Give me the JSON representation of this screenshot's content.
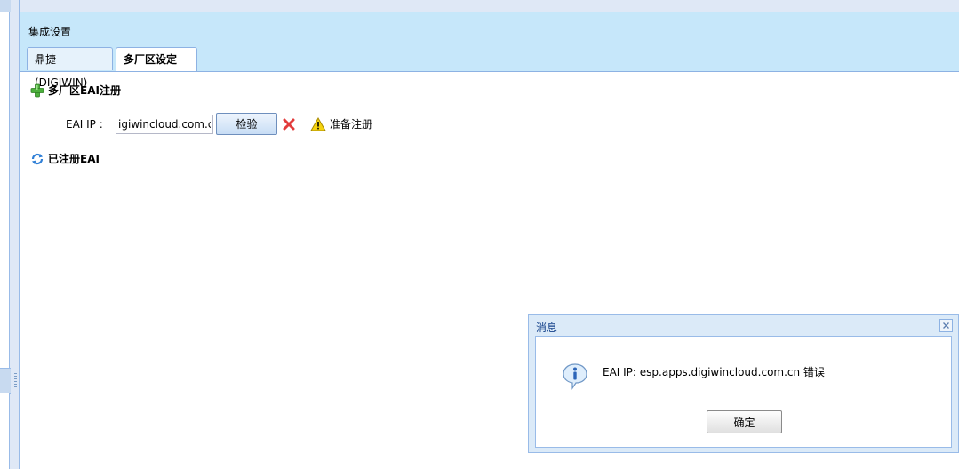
{
  "panel": {
    "title": "集成设置",
    "tabs": [
      {
        "label": "鼎捷(DIGIWIN)",
        "active": false
      },
      {
        "label": "多厂区设定",
        "active": true
      }
    ]
  },
  "register_section": {
    "title": "多厂区EAI注册",
    "icon": "plus-icon",
    "ip_label": "EAI IP :",
    "ip_value": "igiwincloud.com.cn",
    "check_button": "检验",
    "clear_icon": "red-x-icon",
    "status_icon": "warning-icon",
    "status_text": "准备注册"
  },
  "registered_section": {
    "title": "已注册EAI",
    "icon": "refresh-icon"
  },
  "message_dialog": {
    "title": "消息",
    "message": "EAI IP: esp.apps.digiwincloud.com.cn 错误",
    "ok_button": "确定",
    "icon": "info-icon"
  },
  "colors": {
    "header_bg": "#c6e7fa",
    "border": "#99bbe8",
    "dialog_bg": "#dbeaf8",
    "error_red": "#e23b3b",
    "warning_yellow": "#f5d30f"
  }
}
